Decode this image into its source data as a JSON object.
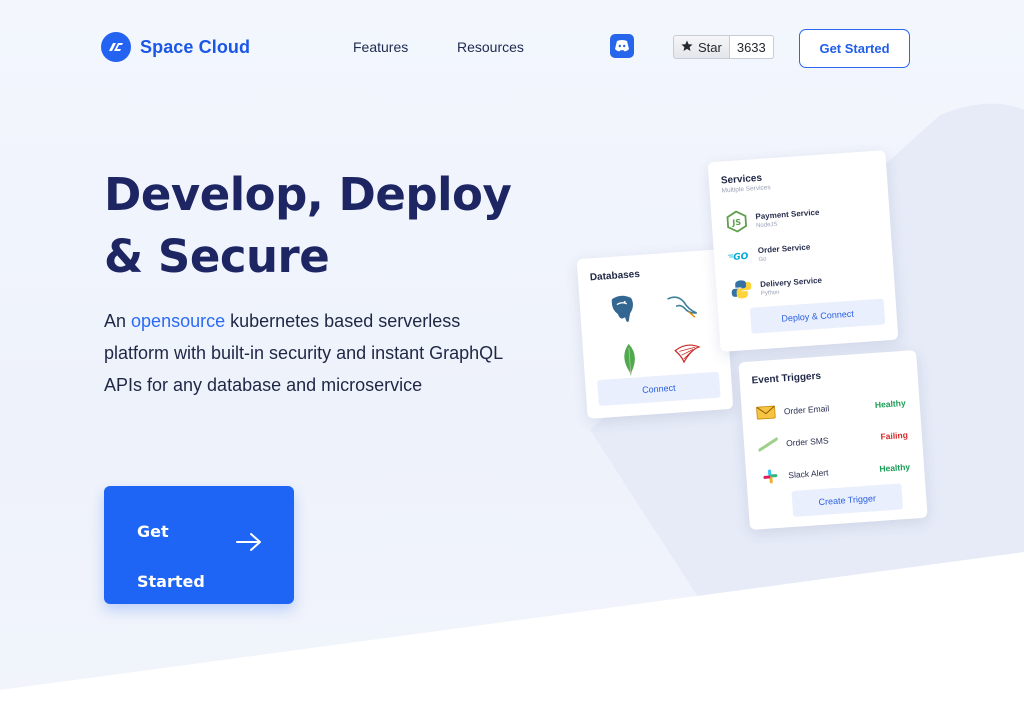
{
  "brand": {
    "name": "Space Cloud",
    "accent": "#1f65f5"
  },
  "nav": {
    "features": "Features",
    "resources": "Resources",
    "star_label": "Star",
    "star_count": "3633",
    "cta": "Get Started"
  },
  "hero": {
    "title_line1": "Develop, Deploy",
    "title_line2": "& Secure",
    "sub_prefix": "An ",
    "sub_highlight": "opensource",
    "sub_rest": " kubernetes based serverless platform with built-in security and instant GraphQL APIs for any database and microservice",
    "cta_line1": "Get",
    "cta_line2": "Started"
  },
  "databases_card": {
    "title": "Databases",
    "icons": [
      "postgresql-icon",
      "mysql-icon",
      "mongodb-icon",
      "sqlserver-icon"
    ],
    "button": "Connect"
  },
  "services_card": {
    "title": "Services",
    "subtitle": "Multiple Services",
    "items": [
      {
        "name": "Payment Service",
        "lang": "NodeJS",
        "icon": "nodejs-icon"
      },
      {
        "name": "Order Service",
        "lang": "Go",
        "icon": "go-icon"
      },
      {
        "name": "Delivery Service",
        "lang": "Python",
        "icon": "python-icon"
      }
    ],
    "button": "Deploy & Connect"
  },
  "events_card": {
    "title": "Event Triggers",
    "items": [
      {
        "name": "Order Email",
        "status": "Healthy",
        "icon": "email-icon"
      },
      {
        "name": "Order SMS",
        "status": "Failing",
        "icon": "sms-icon"
      },
      {
        "name": "Slack Alert",
        "status": "Healthy",
        "icon": "slack-icon"
      }
    ],
    "button": "Create Trigger"
  }
}
